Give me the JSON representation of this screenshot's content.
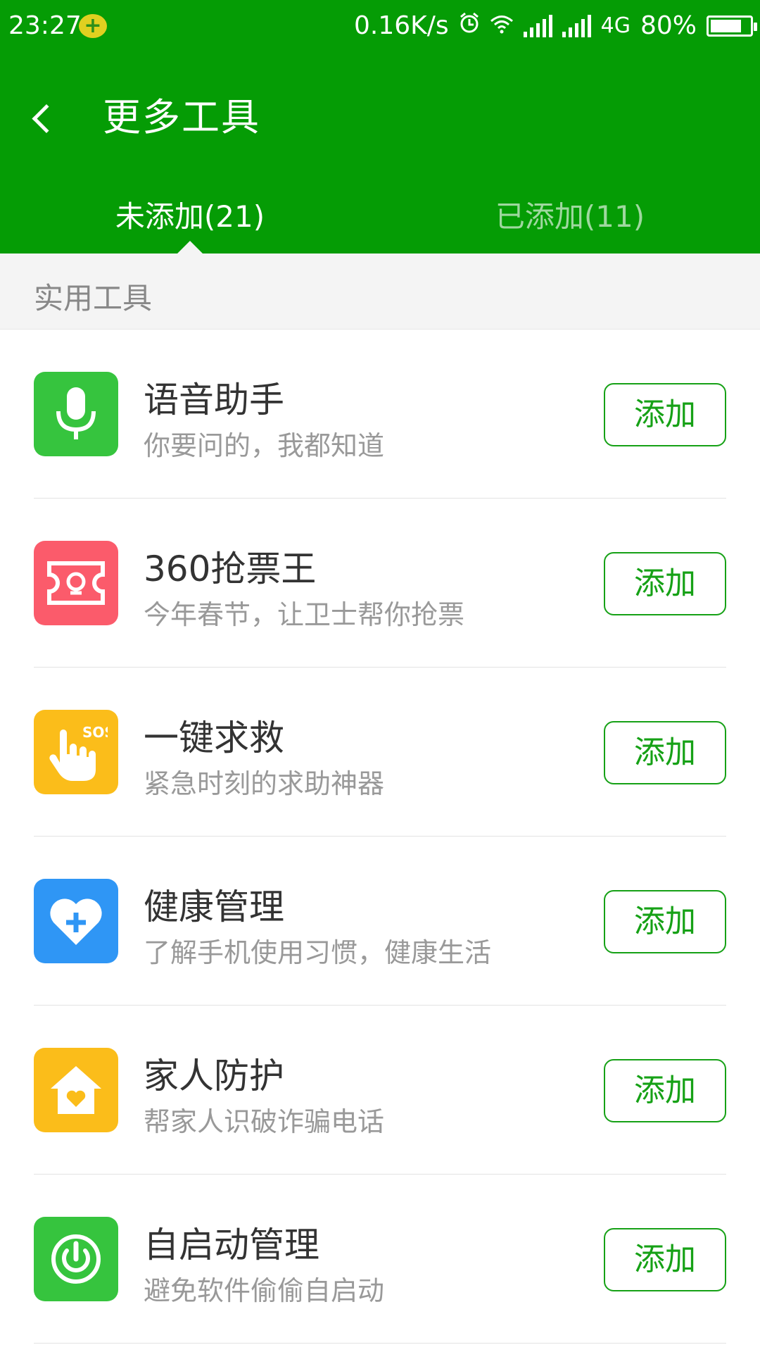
{
  "status_bar": {
    "time": "23:27",
    "badge_icon": "plus-badge-icon",
    "speed": "0.16K/s",
    "network": "4G",
    "battery": "80%",
    "battery_level": 0.8
  },
  "header": {
    "title": "更多工具",
    "back_icon": "back-arrow-icon",
    "background_color": "#059c05"
  },
  "tabs": [
    {
      "label": "未添加(21)",
      "active": true
    },
    {
      "label": "已添加(11)",
      "active": false
    }
  ],
  "section": {
    "label": "实用工具"
  },
  "tools": [
    {
      "name": "语音助手",
      "desc": "你要问的，我都知道",
      "icon": "microphone-icon",
      "color": "#36c43e",
      "button": "添加"
    },
    {
      "name": "360抢票王",
      "desc": "今年春节，让卫士帮你抢票",
      "icon": "train-ticket-icon",
      "color": "#fb5b6b",
      "button": "添加"
    },
    {
      "name": "一键求救",
      "desc": "紧急时刻的求助神器",
      "icon": "sos-hand-icon",
      "color": "#fbbd1a",
      "button": "添加"
    },
    {
      "name": "健康管理",
      "desc": "了解手机使用习惯，健康生活",
      "icon": "heart-plus-icon",
      "color": "#2f96f5",
      "button": "添加"
    },
    {
      "name": "家人防护",
      "desc": "帮家人识破诈骗电话",
      "icon": "house-heart-icon",
      "color": "#fbbd1a",
      "button": "添加"
    },
    {
      "name": "自启动管理",
      "desc": "避免软件偷偷自启动",
      "icon": "power-icon",
      "color": "#36c43e",
      "button": "添加"
    }
  ]
}
